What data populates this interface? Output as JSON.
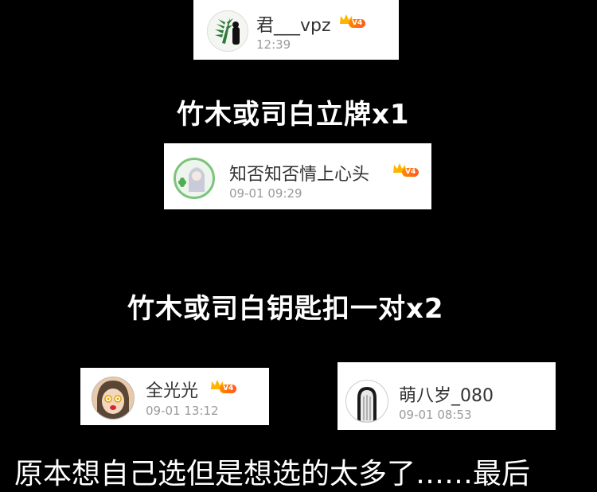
{
  "winners": [
    {
      "name": "君___vpz",
      "time": "12:39",
      "level": "V4"
    },
    {
      "name": "知否知否情上心头",
      "time": "09-01 09:29",
      "level": "V4"
    },
    {
      "name": "全光光",
      "time": "09-01 13:12",
      "level": "V4"
    },
    {
      "name": "萌八岁_080",
      "time": "09-01 08:53"
    }
  ],
  "prizes": [
    {
      "label": "竹木或司白立牌x1"
    },
    {
      "label": "竹木或司白钥匙扣一对x2"
    }
  ],
  "footer_text": "原本想自己选但是想选的太多了……最后",
  "colors": {
    "background": "#000000",
    "card": "#ffffff",
    "badge_orange": "#ff6a13",
    "timestamp": "#9a9a9a"
  }
}
